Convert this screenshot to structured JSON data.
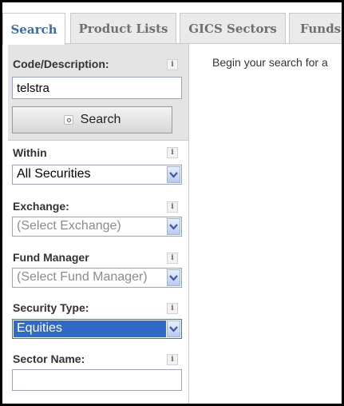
{
  "tabs": [
    {
      "label": "Search",
      "active": true
    },
    {
      "label": "Product Lists",
      "active": false
    },
    {
      "label": "GICS Sectors",
      "active": false
    },
    {
      "label": "Funds",
      "active": false
    }
  ],
  "sidebar": {
    "code": {
      "label": "Code/Description:",
      "info": "i",
      "value": "telstra",
      "search_button": "Search"
    },
    "within": {
      "label": "Within",
      "info": "i",
      "selected": "All Securities"
    },
    "exchange": {
      "label": "Exchange:",
      "info": "i",
      "selected": "(Select Exchange)"
    },
    "fund_manager": {
      "label": "Fund Manager",
      "info": "i",
      "selected": "(Select Fund Manager)"
    },
    "security_type": {
      "label": "Security Type:",
      "info": "i",
      "selected": "Equities"
    },
    "sector_name": {
      "label": "Sector Name:",
      "info": "i",
      "value": ""
    }
  },
  "main": {
    "intro": "Begin your search for a"
  },
  "colors": {
    "active_tab_text": "#3a6ea8",
    "selection_highlight": "#316ac5"
  }
}
